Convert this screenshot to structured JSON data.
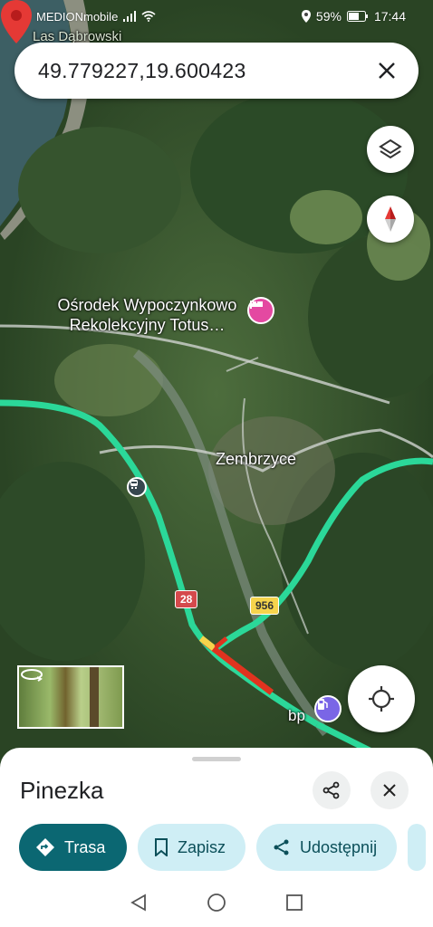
{
  "status_bar": {
    "carrier": "MEDIONmobile",
    "battery": "59%",
    "time": "17:44"
  },
  "search": {
    "query": "49.779227,19.600423"
  },
  "map": {
    "labels": {
      "area_top": "Las Dąbrowski",
      "place": "Ośrodek Wypoczynkowo Rekolekcyjny Totus…",
      "town": "Zembrzyce",
      "gas_station": "bp"
    },
    "road_badges": [
      "28",
      "956"
    ],
    "colors": {
      "traffic_green": "#2bd899",
      "traffic_red": "#e0331f",
      "pin_red": "#e53935",
      "hotel_pin": "#e449a1",
      "gas_pin": "#7a66e6"
    }
  },
  "sheet": {
    "title": "Pinezka",
    "actions": {
      "directions": "Trasa",
      "save": "Zapisz",
      "share": "Udostępnij"
    }
  },
  "icons": [
    "close-icon",
    "layers-icon",
    "compass-icon",
    "my-location-icon",
    "share-icon",
    "directions-icon",
    "bookmark-icon",
    "hotel-icon",
    "gas-station-icon",
    "train-icon",
    "back-icon",
    "home-icon",
    "recents-icon"
  ]
}
